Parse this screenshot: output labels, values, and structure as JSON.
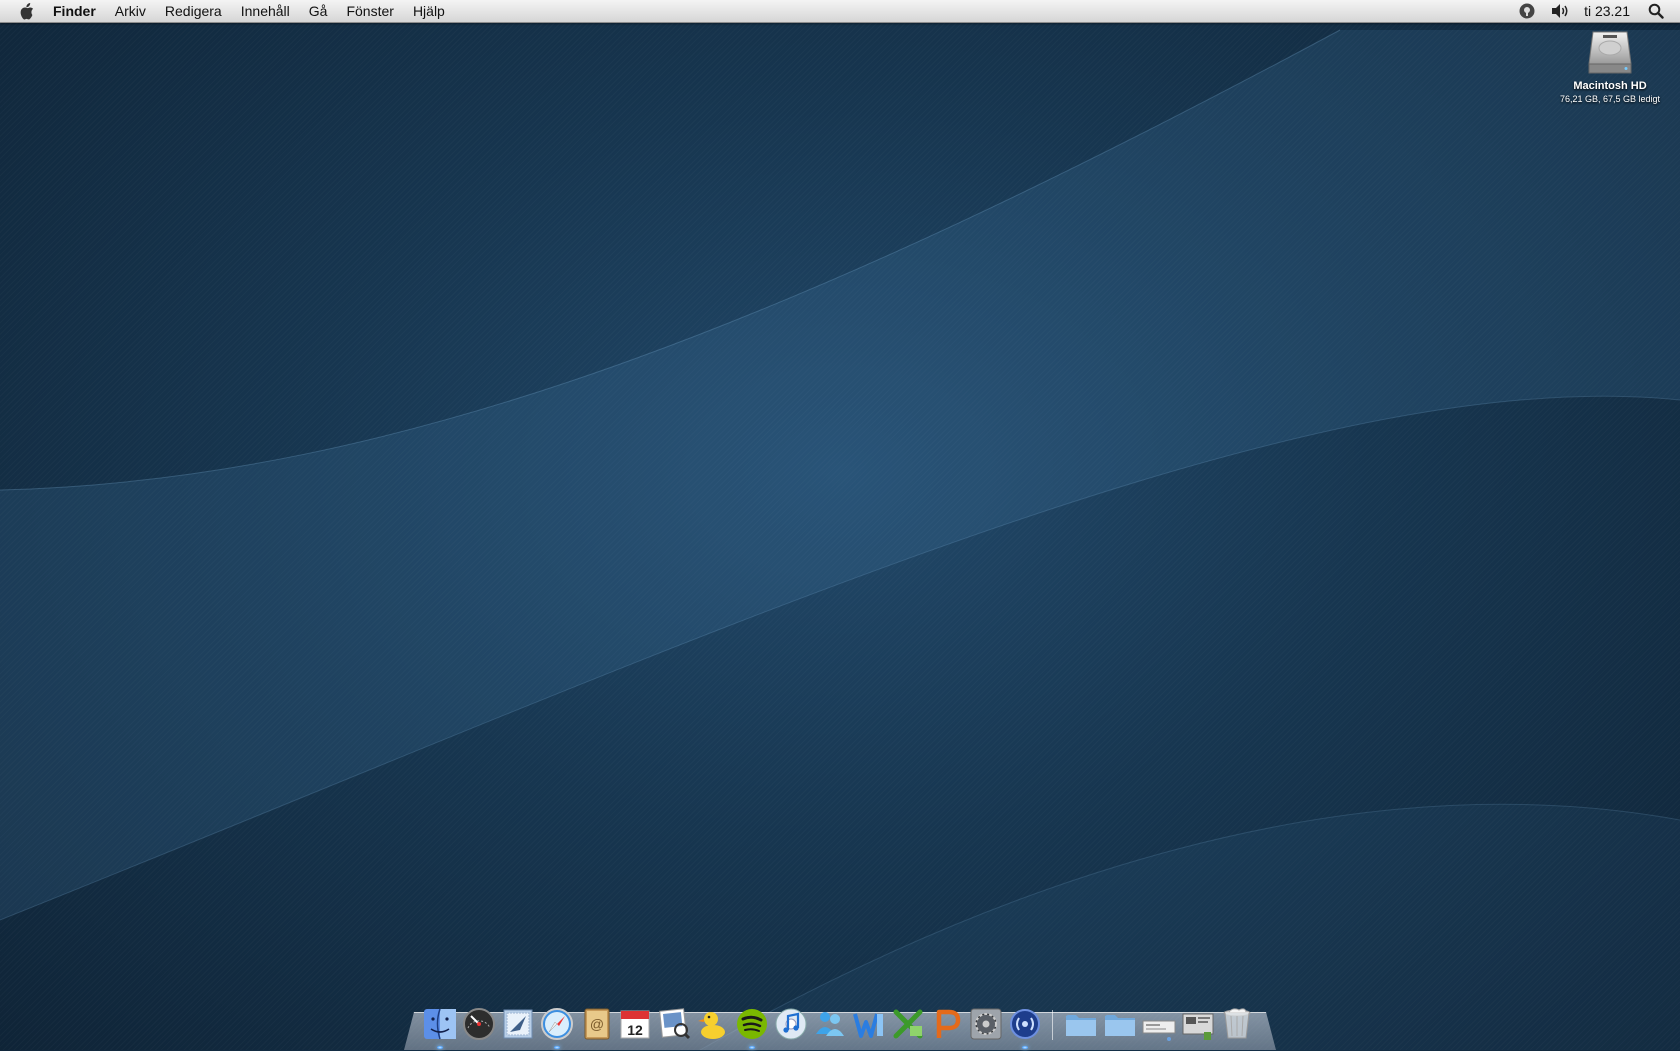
{
  "menubar": {
    "apple_icon": "apple-icon",
    "items": [
      "Finder",
      "Arkiv",
      "Redigera",
      "Innehåll",
      "Gå",
      "Fönster",
      "Hjälp"
    ],
    "status_icons": [
      "sync-icon",
      "volume-icon"
    ],
    "clock": "ti 23.21",
    "spotlight_icon": "search-icon"
  },
  "desktop": {
    "drive": {
      "name": "Macintosh HD",
      "info": "76,21 GB, 67,5 GB ledigt",
      "icon": "hard-drive-icon"
    }
  },
  "dock": {
    "apps": [
      {
        "icon": "finder-icon",
        "running": true
      },
      {
        "icon": "dashboard-icon",
        "running": false
      },
      {
        "icon": "mail-icon",
        "running": false
      },
      {
        "icon": "safari-icon",
        "running": true
      },
      {
        "icon": "address-book-icon",
        "running": false
      },
      {
        "icon": "ical-icon",
        "running": false
      },
      {
        "icon": "preview-icon",
        "running": false
      },
      {
        "icon": "cyberduck-icon",
        "running": false
      },
      {
        "icon": "spotify-icon",
        "running": true
      },
      {
        "icon": "itunes-icon",
        "running": false
      },
      {
        "icon": "messenger-icon",
        "running": false
      },
      {
        "icon": "word-icon",
        "running": false
      },
      {
        "icon": "excel-icon",
        "running": false
      },
      {
        "icon": "powerpoint-icon",
        "running": false
      },
      {
        "icon": "system-preferences-icon",
        "running": false
      },
      {
        "icon": "activity-icon",
        "running": true
      }
    ],
    "stacks": [
      {
        "icon": "folder-icon"
      },
      {
        "icon": "folder-icon"
      },
      {
        "icon": "downloads-stack-icon"
      },
      {
        "icon": "documents-stack-icon"
      },
      {
        "icon": "trash-icon"
      }
    ]
  },
  "colors": {
    "wallpaper_dark": "#0f2437",
    "wallpaper_light": "#22496a",
    "menubar": "#e4e4e4"
  }
}
